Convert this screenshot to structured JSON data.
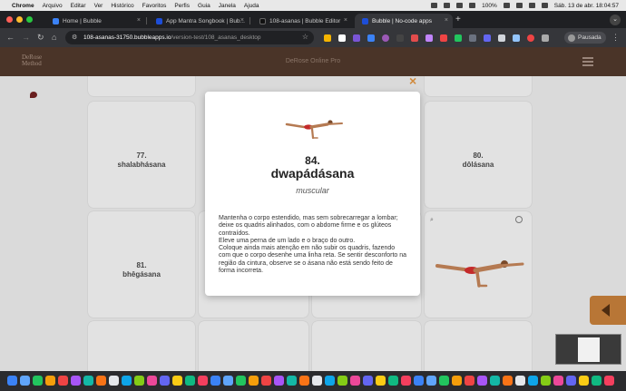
{
  "menubar": {
    "app": "Chrome",
    "items": [
      "Arquivo",
      "Editar",
      "Ver",
      "Histórico",
      "Favoritos",
      "Perfis",
      "Guia",
      "Janela",
      "Ajuda"
    ],
    "battery": "100%",
    "clock": "Sáb. 13 de abr. 18:04:57"
  },
  "tabs": [
    {
      "label": "Home | Bubble",
      "color": "#3b82f6"
    },
    {
      "label": "App Mantra Songbook | Bub...",
      "color": "#1d4ed8"
    },
    {
      "label": "108-asanas | Bubble Editor",
      "color": "#111111"
    },
    {
      "label": "Bubble | No-code apps",
      "color": "#1d4ed8"
    }
  ],
  "browser": {
    "url_host": "108-asanas-31750.bubbleapps.io",
    "url_path": "/version-test/108_asanas_desktop",
    "profile_label": "Pausada"
  },
  "site": {
    "logo_line1": "DeRose",
    "logo_line2": "Method",
    "title": "DeRose Online Pro"
  },
  "cards": [
    {
      "number": "77.",
      "name": "shalabhásana"
    },
    {
      "number": "80.",
      "name": "dôlásana"
    },
    {
      "number": "81.",
      "name": "bhêgásana"
    }
  ],
  "modal": {
    "close_label": "×",
    "number": "84.",
    "name": "dwapádásana",
    "type": "muscular",
    "description": "Mantenha o corpo estendido, mas sem sobrecarregar a lombar; deixe os quadris alinhados, com o abdome firme e os glúteos contraídos.\nEleve uma perna de um lado e o braço do outro.\nColoque ainda mais atenção em não subir os quadris, fazendo com que o corpo desenhe uma linha reta. Se sentir desconforto na região da cintura, observe se o ásana não está sendo feito de forma incorreta."
  },
  "colors": {
    "header": "#4a3428",
    "accent": "#d18a3c",
    "side_button": "#b87636"
  }
}
